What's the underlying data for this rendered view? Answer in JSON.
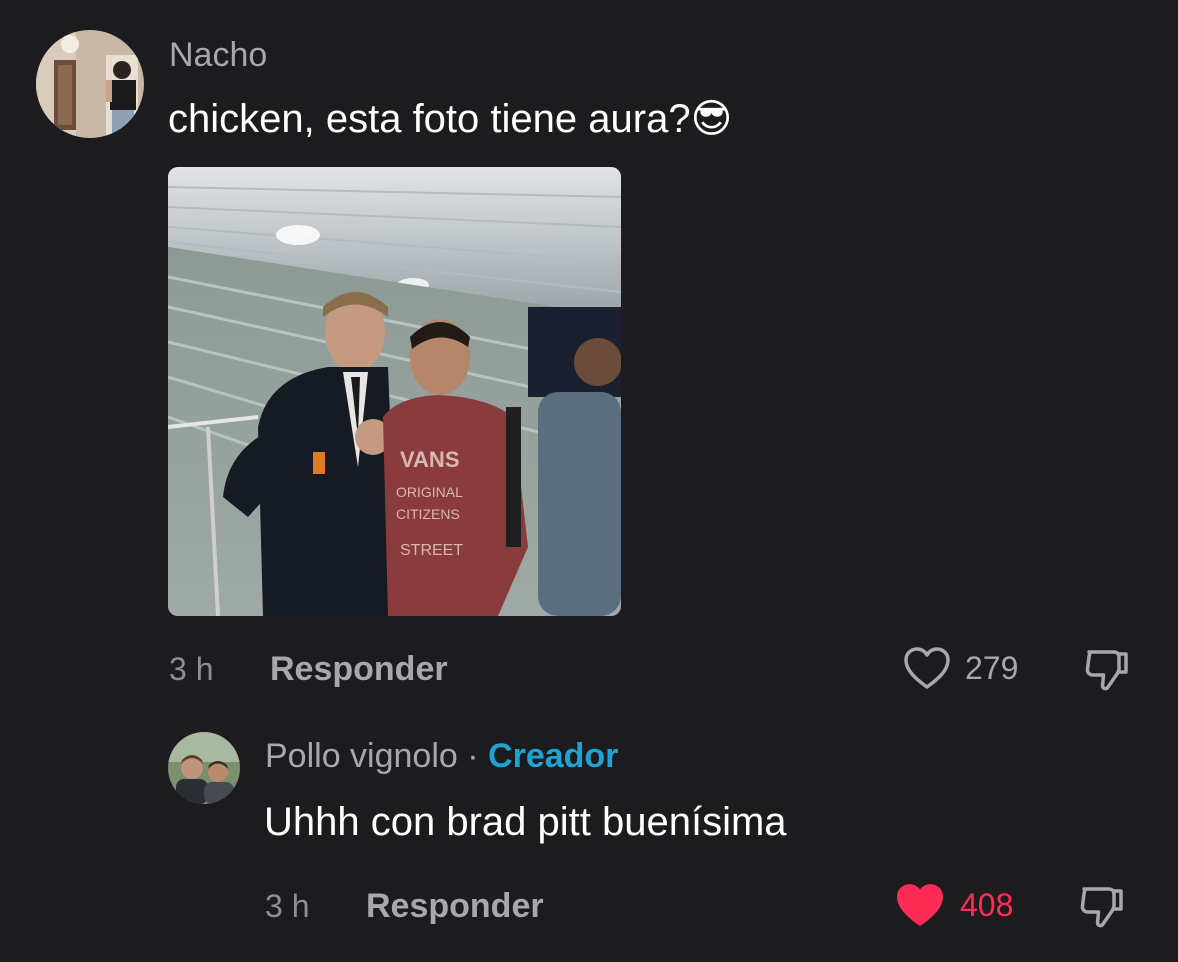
{
  "comments": [
    {
      "username": "Nacho",
      "text": "chicken, esta foto tiene aura?",
      "emoji": "😎",
      "has_image": true,
      "time": "3 h",
      "reply_label": "Responder",
      "likes": "279",
      "liked": false
    },
    {
      "username": "Pollo vignolo",
      "separator": "·",
      "badge": "Creador",
      "text": "Uhhh con brad pitt buenísima",
      "time": "3 h",
      "reply_label": "Responder",
      "likes": "408",
      "liked": true
    }
  ],
  "colors": {
    "background": "#1c1c1e",
    "liked": "#fe2c55",
    "creator": "#1fa3d4",
    "muted": "#a8a8ab"
  },
  "icons": {
    "like": "heart-outline-icon",
    "liked": "heart-filled-icon",
    "dislike": "thumbs-down-icon"
  }
}
